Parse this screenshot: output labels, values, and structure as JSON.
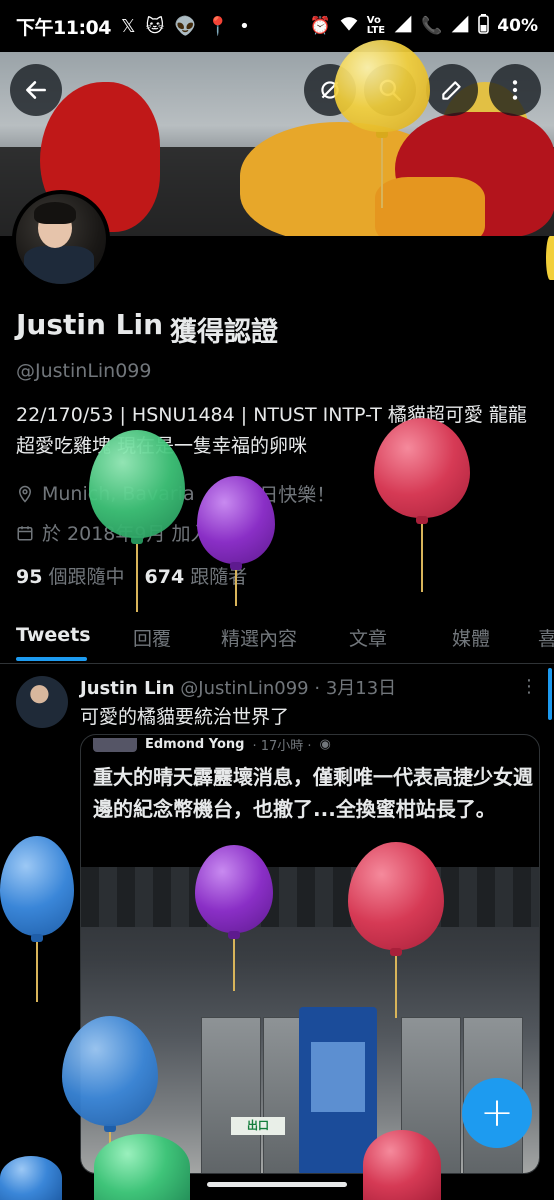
{
  "status_bar": {
    "time": "下午11:04",
    "battery": "40%",
    "icons": [
      "x-icon",
      "cat-icon",
      "reddit-icon",
      "location-icon",
      "dot-icon",
      "alarm-icon",
      "wifi-icon",
      "volte-icon",
      "signal-icon",
      "call-icon",
      "signal-icon",
      "battery-icon"
    ],
    "volte_label": "VoLTE"
  },
  "header": {
    "back_icon": "back-arrow-icon",
    "actions": [
      "refresh-icon",
      "search-icon",
      "edit-icon",
      "more-vertical-icon"
    ]
  },
  "profile": {
    "name": "Justin Lin",
    "verified_label": "獲得認證",
    "handle": "@JustinLin099",
    "bio_line1": "22/170/53 | HSNU1484 | NTUST INTP-T 橘貓超可愛 龍龍",
    "bio_line2": "超愛吃雞塊 現在是一隻幸福的卵咪",
    "location": "Munich, Bavaria",
    "birthday": "生日快樂！",
    "joined": "於 2018年9月 加入",
    "following_count": "95",
    "following_label": "個跟隨中",
    "followers_count": "674",
    "followers_label": "跟隨者"
  },
  "tabs": [
    "Tweets",
    "回覆",
    "精選內容",
    "文章",
    "媒體",
    "喜"
  ],
  "active_tab": "Tweets",
  "tweet": {
    "author": "Justin Lin",
    "handle": "@JustinLin099",
    "date": "· 3月13日",
    "text": "可愛的橘貓要統治世界了",
    "quote": {
      "author": "Edmond Yong",
      "time": "· 17小時 ·",
      "text": "重大的晴天霹靂壞消息，僅剩唯一代表高捷少女週邊的紀念幣機台，也撤了...全換蜜柑站長了。",
      "image_sign": "出口"
    }
  },
  "fab_label": "+",
  "colors": {
    "accent": "#1d9bf0",
    "background": "#000000",
    "text": "#e7e9ea",
    "secondary": "#71767b",
    "balloon_yellow": "#f2cf3a",
    "balloon_red": "#d63a55",
    "balloon_green": "#3fc479",
    "balloon_purple": "#8a2fc6",
    "balloon_blue": "#3a86d8"
  }
}
